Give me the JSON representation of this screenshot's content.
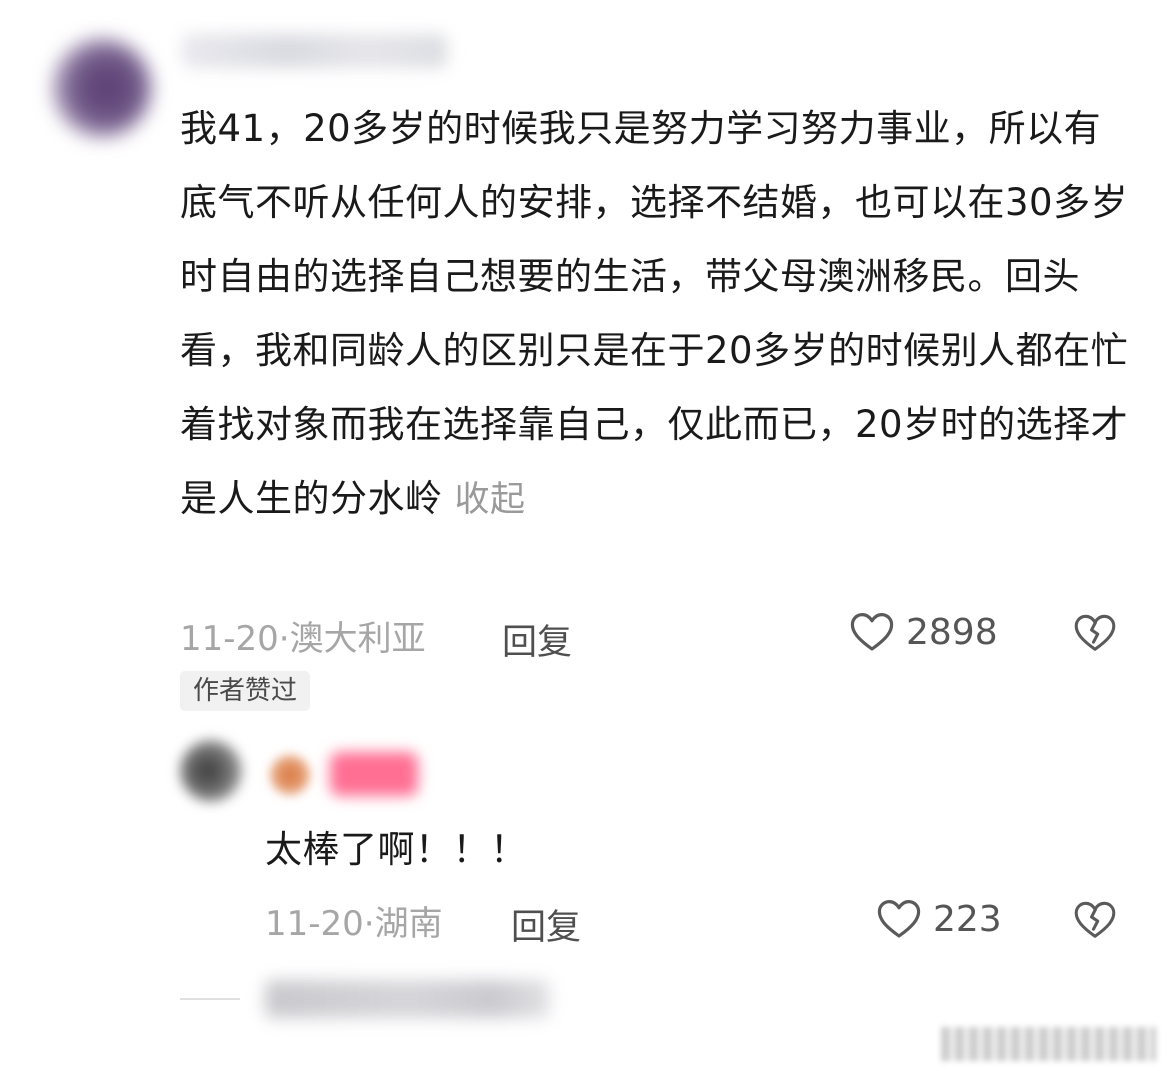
{
  "comment": {
    "text": "我41，20多岁的时候我只是努力学习努力事业，所以有底气不听从任何人的安排，选择不结婚，也可以在30多岁时自由的选择自己想要的生活，带父母澳洲移民。回头看，我和同龄人的区别只是在于20多岁的时候别人都在忙着找对象而我在选择靠自己，仅此而已，20岁时的选择才是人生的分水岭",
    "collapse_label": "收起",
    "time_location": "11-20·澳大利亚",
    "reply_label": "回复",
    "like_count": "2898",
    "author_badge": "作者赞过"
  },
  "reply": {
    "text": "太棒了啊！！！",
    "time_location": "11-20·湖南",
    "reply_label": "回复",
    "like_count": "223"
  },
  "icons": {
    "like": "heart-outline-icon",
    "dislike": "broken-heart-icon"
  },
  "colors": {
    "text": "#1a1a1a",
    "muted": "#a6a6a6",
    "reply_tag": "#ff6f94"
  }
}
